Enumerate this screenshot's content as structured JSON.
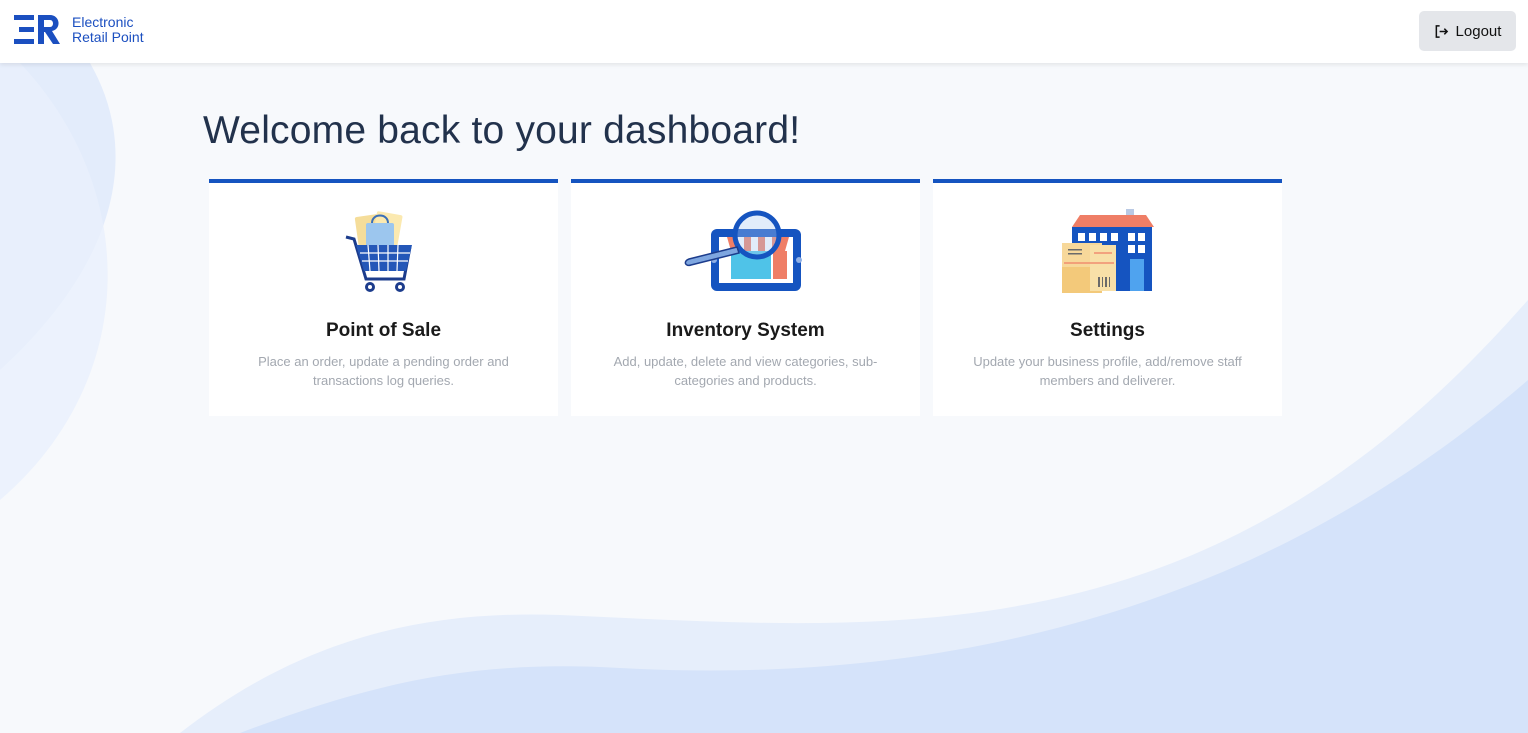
{
  "brand": {
    "line1": "Electronic",
    "line2": "Retail Point"
  },
  "header": {
    "logout_label": "Logout"
  },
  "main": {
    "title": "Welcome back to your dashboard!"
  },
  "cards": [
    {
      "title": "Point of Sale",
      "description": "Place an order, update a pending order and transactions log queries.",
      "icon": "shopping-cart-icon"
    },
    {
      "title": "Inventory System",
      "description": "Add, update, delete and view categories, sub-categories and products.",
      "icon": "store-search-icon"
    },
    {
      "title": "Settings",
      "description": "Update your business profile, add/remove staff members and deliverer.",
      "icon": "building-parcels-icon"
    }
  ],
  "colors": {
    "accent": "#1554c0",
    "title": "#22324c",
    "background": "#f7f9fc"
  }
}
